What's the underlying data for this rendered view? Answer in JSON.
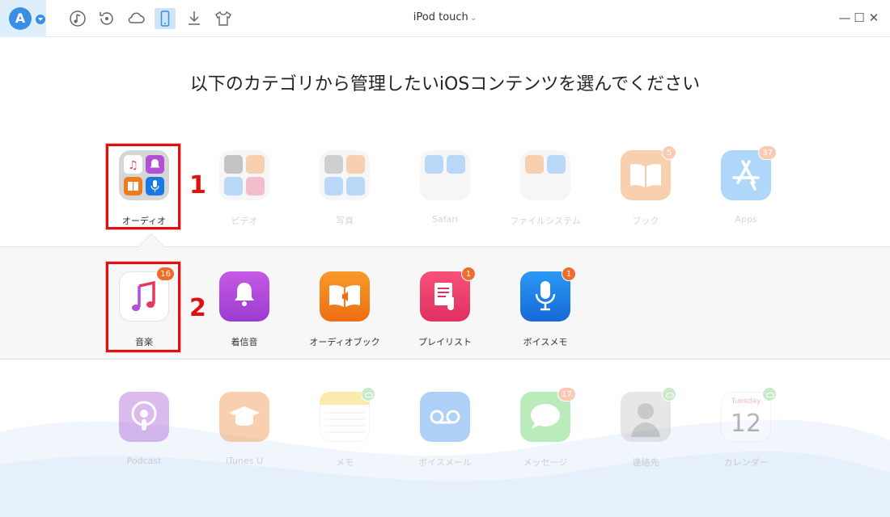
{
  "topbar": {
    "logo_letter": "A",
    "device_name": "iPod touch",
    "device_chevron": "⌄",
    "tools": [
      "music-circle-icon",
      "restore-icon",
      "cloud-icon",
      "device-icon",
      "download-icon",
      "tshirt-icon"
    ],
    "minimize": "—",
    "maximize": "☐",
    "close": "✕"
  },
  "heading": "以下のカテゴリから管理したいiOSコンテンツを選んでください",
  "categories": [
    {
      "label": "オーディオ",
      "icon": "audio-folder-icon"
    },
    {
      "label": "ビデオ",
      "icon": "video-folder-icon"
    },
    {
      "label": "写真",
      "icon": "photo-folder-icon"
    },
    {
      "label": "Safari",
      "icon": "safari-folder-icon"
    },
    {
      "label": "ファイルシステム",
      "icon": "filesystem-folder-icon"
    },
    {
      "label": "ブック",
      "icon": "books-icon",
      "badge": "5"
    },
    {
      "label": "Apps",
      "icon": "app-store-icon",
      "badge": "37"
    }
  ],
  "audio_items": [
    {
      "label": "音楽",
      "icon": "music-icon",
      "badge": "16"
    },
    {
      "label": "着信音",
      "icon": "ringtone-bell-icon"
    },
    {
      "label": "オーディオブック",
      "icon": "audiobook-icon"
    },
    {
      "label": "プレイリスト",
      "icon": "playlist-icon",
      "badge": "1"
    },
    {
      "label": "ボイスメモ",
      "icon": "voice-memo-icon",
      "badge": "1"
    }
  ],
  "other_items": [
    {
      "label": "Podcast",
      "icon": "podcast-icon"
    },
    {
      "label": "iTunes U",
      "icon": "itunes-u-icon"
    },
    {
      "label": "メモ",
      "icon": "notes-icon",
      "cloud": true
    },
    {
      "label": "ボイスメール",
      "icon": "voicemail-icon"
    },
    {
      "label": "メッセージ",
      "icon": "messages-icon",
      "badge": "17"
    },
    {
      "label": "連絡先",
      "icon": "contacts-icon",
      "cloud": true
    },
    {
      "label": "カレンダー",
      "icon": "calendar-icon",
      "cloud": true,
      "cal_day": "Tuesday",
      "cal_date": "12"
    }
  ],
  "annotations": {
    "step1": "1",
    "step2": "2"
  }
}
